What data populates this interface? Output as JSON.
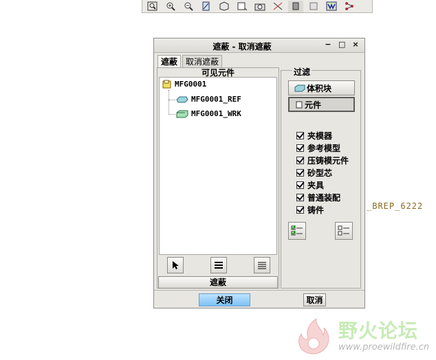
{
  "background_label": "_BREP_6222",
  "toolbar": {
    "icons": [
      "zoom-window-icon",
      "zoom-in-icon",
      "zoom-out-icon",
      "refit-icon",
      "shading-icon",
      "saved-views-icon",
      "snapshot-icon",
      "datum-display-icon",
      "hide-tool-icon",
      "component-icon",
      "manufacturing-icon",
      "connections-icon"
    ]
  },
  "dialog": {
    "title": "遮蔽 - 取消遮蔽",
    "window_buttons": [
      "−",
      "□",
      "×"
    ],
    "tabs": [
      "遮蔽",
      "取消遮蔽"
    ],
    "visible_header": "可见元件",
    "tree": {
      "root": "MFG0001",
      "children": [
        "MFG0001_REF",
        "MFG0001_WRK"
      ]
    },
    "hide_button": "遮蔽",
    "filter": {
      "label": "过滤",
      "buttons": [
        "体积块",
        "元件"
      ],
      "checkboxes": [
        "夹模器",
        "参考模型",
        "压铸模元件",
        "砂型芯",
        "夹具",
        "普通装配",
        "铸件"
      ]
    },
    "close_button": "关闭",
    "cancel_button": "取消"
  },
  "watermark": {
    "text": "野火论坛",
    "url": "www.proewildfire.cn"
  }
}
